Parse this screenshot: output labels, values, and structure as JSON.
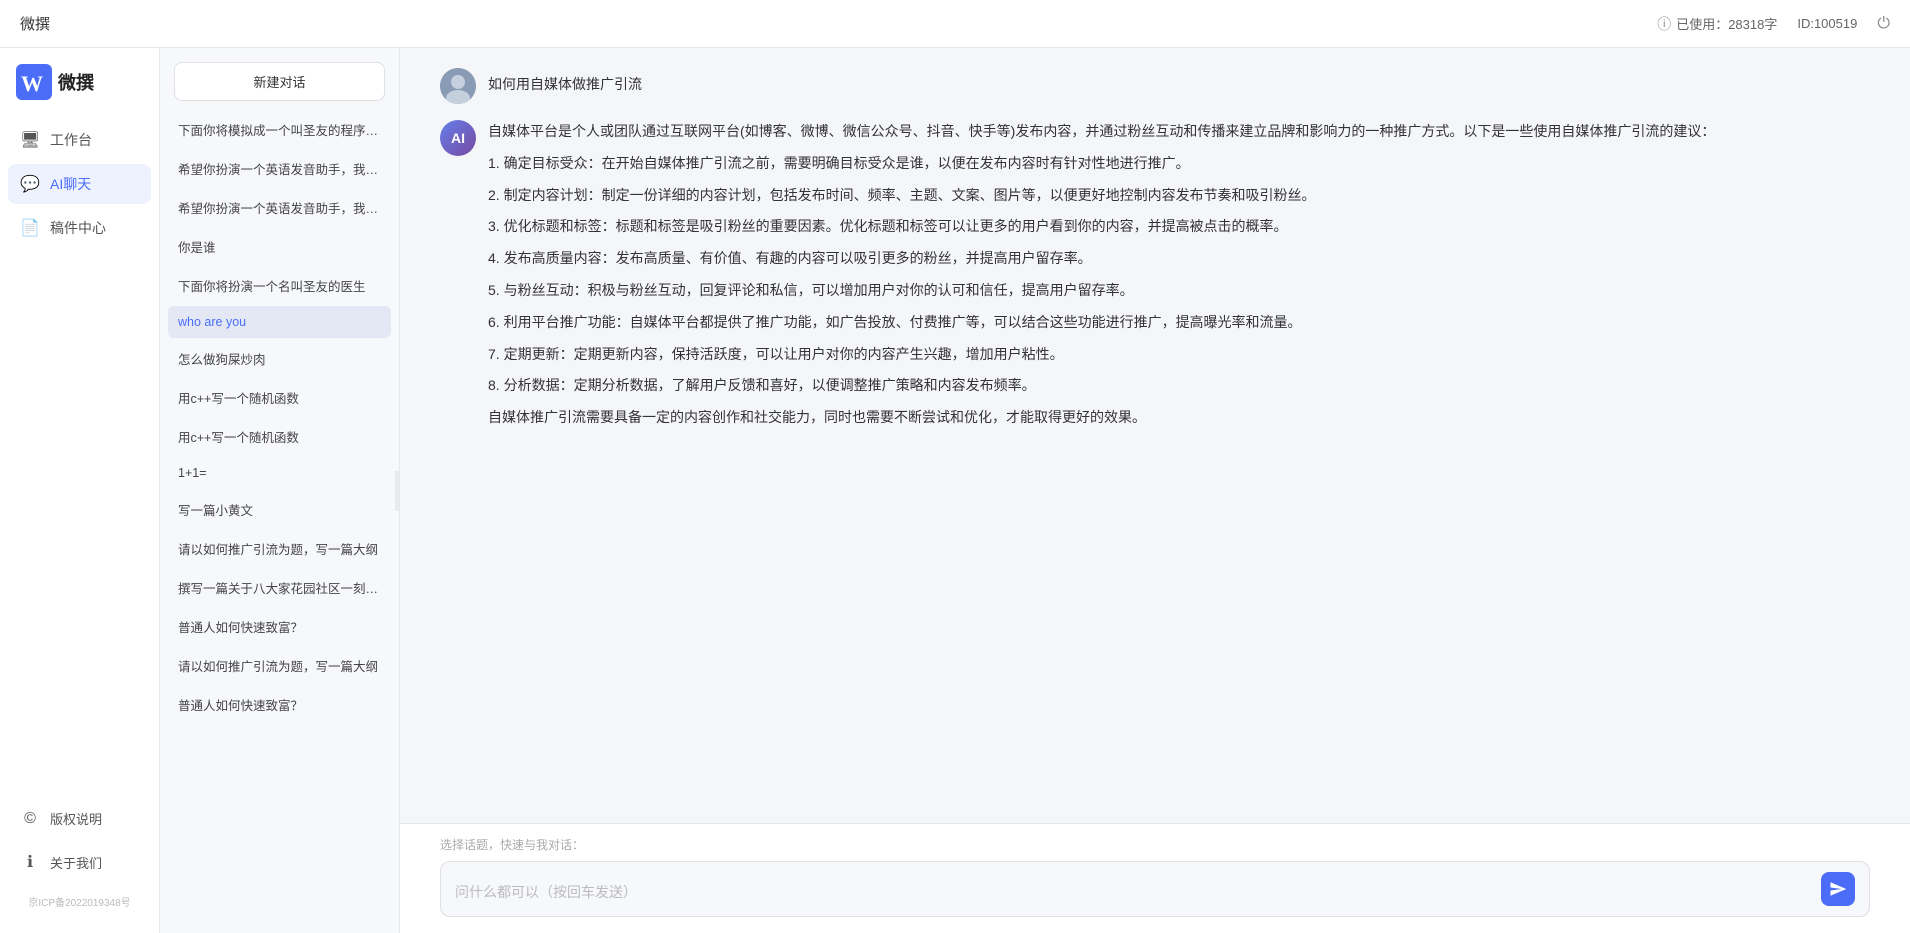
{
  "app": {
    "title": "微撰",
    "logo_text": "微撰",
    "usage_label": "已使用：28318字",
    "id_label": "ID:100519"
  },
  "nav": {
    "items": [
      {
        "id": "workbench",
        "label": "工作台",
        "icon": "🖥"
      },
      {
        "id": "ai-chat",
        "label": "AI聊天",
        "icon": "💬",
        "active": true
      },
      {
        "id": "drafts",
        "label": "稿件中心",
        "icon": "📄"
      }
    ],
    "bottom_items": [
      {
        "id": "copyright",
        "label": "版权说明",
        "icon": "©"
      },
      {
        "id": "about",
        "label": "关于我们",
        "icon": "ℹ"
      }
    ],
    "icp": "京ICP备2022019348号"
  },
  "history": {
    "new_chat_label": "新建对话",
    "items": [
      {
        "id": 1,
        "text": "下面你将模拟成一个叫圣友的程序员，我说...",
        "active": false
      },
      {
        "id": 2,
        "text": "希望你扮演一个英语发音助手，我提供给你...",
        "active": false
      },
      {
        "id": 3,
        "text": "希望你扮演一个英语发音助手，我提供给你...",
        "active": false
      },
      {
        "id": 4,
        "text": "你是谁",
        "active": false
      },
      {
        "id": 5,
        "text": "下面你将扮演一个名叫圣友的医生",
        "active": false
      },
      {
        "id": 6,
        "text": "who are you",
        "active": true
      },
      {
        "id": 7,
        "text": "怎么做狗屎炒肉",
        "active": false
      },
      {
        "id": 8,
        "text": "用c++写一个随机函数",
        "active": false
      },
      {
        "id": 9,
        "text": "用c++写一个随机函数",
        "active": false
      },
      {
        "id": 10,
        "text": "1+1=",
        "active": false
      },
      {
        "id": 11,
        "text": "写一篇小黄文",
        "active": false
      },
      {
        "id": 12,
        "text": "请以如何推广引流为题，写一篇大纲",
        "active": false
      },
      {
        "id": 13,
        "text": "撰写一篇关于八大家花园社区一刻钟便民生...",
        "active": false
      },
      {
        "id": 14,
        "text": "普通人如何快速致富？",
        "active": false
      },
      {
        "id": 15,
        "text": "请以如何推广引流为题，写一篇大纲",
        "active": false
      },
      {
        "id": 16,
        "text": "普通人如何快速致富？",
        "active": false
      }
    ]
  },
  "chat": {
    "user_question": "如何用自媒体做推广引流",
    "ai_response_paragraphs": [
      "自媒体平台是个人或团队通过互联网平台(如博客、微博、微信公众号、抖音、快手等)发布内容，并通过粉丝互动和传播来建立品牌和影响力的一种推广方式。以下是一些使用自媒体推广引流的建议：",
      "1. 确定目标受众：在开始自媒体推广引流之前，需要明确目标受众是谁，以便在发布内容时有针对性地进行推广。",
      "2. 制定内容计划：制定一份详细的内容计划，包括发布时间、频率、主题、文案、图片等，以便更好地控制内容发布节奏和吸引粉丝。",
      "3. 优化标题和标签：标题和标签是吸引粉丝的重要因素。优化标题和标签可以让更多的用户看到你的内容，并提高被点击的概率。",
      "4. 发布高质量内容：发布高质量、有价值、有趣的内容可以吸引更多的粉丝，并提高用户留存率。",
      "5. 与粉丝互动：积极与粉丝互动，回复评论和私信，可以增加用户对你的认可和信任，提高用户留存率。",
      "6. 利用平台推广功能：自媒体平台都提供了推广功能，如广告投放、付费推广等，可以结合这些功能进行推广，提高曝光率和流量。",
      "7. 定期更新：定期更新内容，保持活跃度，可以让用户对你的内容产生兴趣，增加用户粘性。",
      "8. 分析数据：定期分析数据，了解用户反馈和喜好，以便调整推广策略和内容发布频率。",
      "自媒体推广引流需要具备一定的内容创作和社交能力，同时也需要不断尝试和优化，才能取得更好的效果。"
    ],
    "quick_topics_label": "选择话题，快速与我对话：",
    "input_placeholder": "问什么都可以（按回车发送）"
  }
}
